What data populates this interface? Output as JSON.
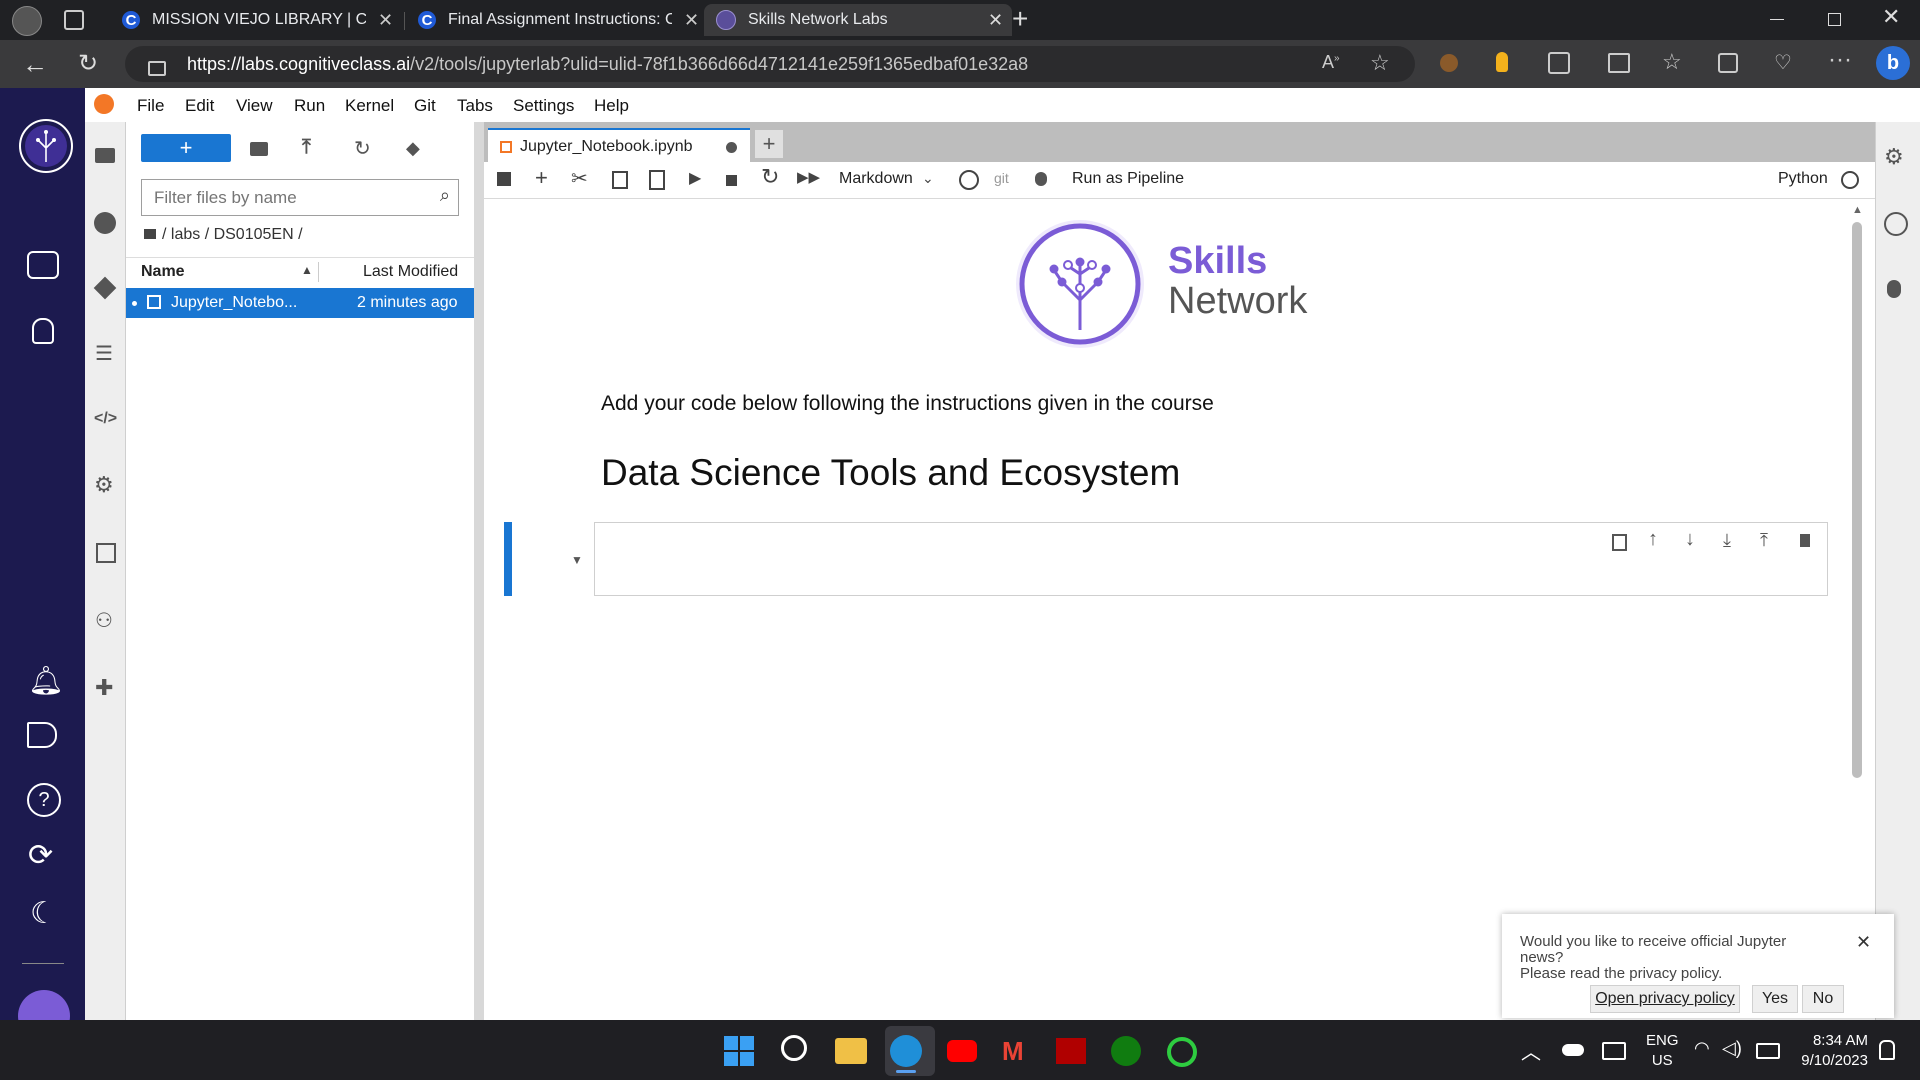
{
  "browser": {
    "tabs": [
      {
        "title": "MISSION VIEJO LIBRARY | Course",
        "active": false
      },
      {
        "title": "Final Assignment Instructions: Cr",
        "active": false
      },
      {
        "title": "Skills Network Labs",
        "active": true
      }
    ],
    "url_host": "https://labs.cognitiveclass.ai",
    "url_path": "/v2/tools/jupyterlab?ulid=ulid-78f1b366d66d4712141e259f1365edbaf01e32a8"
  },
  "jupyter": {
    "menu": [
      "File",
      "Edit",
      "View",
      "Run",
      "Kernel",
      "Git",
      "Tabs",
      "Settings",
      "Help"
    ],
    "filebrowser": {
      "filter_placeholder": "Filter files by name",
      "breadcrumb": "/ labs / DS0105EN /",
      "col_name": "Name",
      "col_modified": "Last Modified",
      "files": [
        {
          "name": "Jupyter_Notebo...",
          "modified": "2 minutes ago",
          "selected": true
        }
      ]
    },
    "notebook": {
      "tab_title": "Jupyter_Notebook.ipynb",
      "cell_type": "Markdown",
      "git_label": "git",
      "pipeline_label": "Run as Pipeline",
      "kernel": "Python",
      "logo_line1": "Skills",
      "logo_line2": "Network",
      "intro_text": "Add your code below following the instructions given in the course",
      "heading": "Data Science Tools and Ecosystem"
    },
    "notification": {
      "question": "Would you like to receive official Jupyter news?",
      "privacy_note": "Please read the privacy policy.",
      "link": "Open privacy policy",
      "yes": "Yes",
      "no": "No"
    }
  },
  "taskbar": {
    "lang1": "ENG",
    "lang2": "US",
    "time": "8:34 AM",
    "date": "9/10/2023"
  },
  "colors": {
    "accent_purple": "#7b5cd6",
    "jupyter_blue": "#1976d2",
    "skills_sidebar": "#1c1a4f"
  }
}
